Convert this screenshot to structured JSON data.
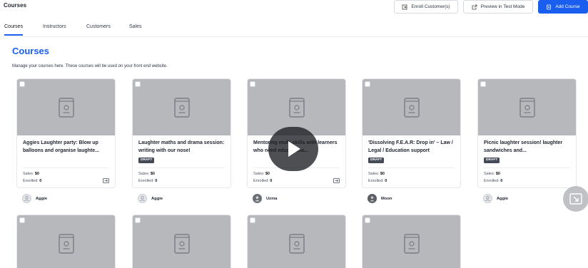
{
  "header": {
    "title": "Courses",
    "buttons": {
      "enroll": "Enroll Customer(s)",
      "preview": "Preview in Test Mode",
      "add": "Add Course"
    }
  },
  "tabs": [
    "Courses",
    "Instructors",
    "Customers",
    "Sales"
  ],
  "page": {
    "title": "Courses",
    "description": "Manage your courses here. These courses will be used on your front end website."
  },
  "stat_labels": {
    "sales": "Sales:",
    "enrolled": "Enrolled:"
  },
  "courses": [
    {
      "title": "Aggies Laughter party: Blow up balloons and organise laughte...",
      "status": "",
      "sales": "$0",
      "enrolled": "0",
      "instructor": "Aggie"
    },
    {
      "title": "Laughter maths and drama session: writing with our nose!",
      "status": "DRAFT",
      "sales": "$0",
      "enrolled": "0",
      "instructor": "Aggie"
    },
    {
      "title": "Mentoring multi-skills with learners who need educationa...",
      "status": "",
      "sales": "$0",
      "enrolled": "0",
      "instructor": "Uzma"
    },
    {
      "title": "'Dissolving F.E.A.R: Drop in' – Law / Legal / Education support",
      "status": "DRAFT",
      "sales": "$0",
      "enrolled": "0",
      "instructor": "Moon"
    },
    {
      "title": "Picnic laughter session! laughter sandwiches and...",
      "status": "DRAFT",
      "sales": "$0",
      "enrolled": "0",
      "instructor": "Aggie"
    }
  ],
  "colors": {
    "accent": "#1a5ef0",
    "thumbnail": "#b6b8bc",
    "draft_badge": "#444a56"
  }
}
